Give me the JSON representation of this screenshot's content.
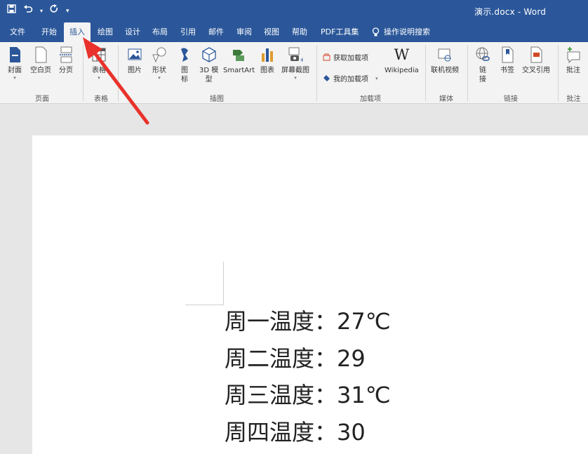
{
  "app": {
    "doc_title": "演示.docx  -  Word",
    "qat_caret": "▾"
  },
  "tabs": [
    {
      "label": "文件"
    },
    {
      "label": "开始"
    },
    {
      "label": "插入"
    },
    {
      "label": "绘图"
    },
    {
      "label": "设计"
    },
    {
      "label": "布局"
    },
    {
      "label": "引用"
    },
    {
      "label": "邮件"
    },
    {
      "label": "审阅"
    },
    {
      "label": "视图"
    },
    {
      "label": "帮助"
    },
    {
      "label": "PDF工具集"
    },
    {
      "label": "操作说明搜索"
    }
  ],
  "ribbon": {
    "pages": {
      "cover": "封面",
      "blank": "空白页",
      "break": "分页",
      "group": "页面"
    },
    "tables": {
      "table": "表格",
      "group": "表格"
    },
    "illus": {
      "picture": "图片",
      "shapes": "形状",
      "icons_1": "图",
      "icons_2": "标",
      "model_1": "3D 模",
      "model_2": "型",
      "smartart": "SmartArt",
      "chart": "图表",
      "screenshot": "屏幕截图",
      "group": "插图"
    },
    "addins": {
      "get": "获取加载项",
      "mine": "我的加载项",
      "wiki": "Wikipedia",
      "wiki_glyph": "W",
      "group": "加载项"
    },
    "media": {
      "video": "联机视频",
      "group": "媒体"
    },
    "links": {
      "link_1": "链",
      "link_2": "接",
      "bookmark": "书签",
      "xref": "交叉引用",
      "group": "链接"
    },
    "comments": {
      "comment": "批注",
      "group": "批注"
    }
  },
  "document": {
    "lines": [
      "周一温度：27℃",
      "周二温度：29",
      "周三温度：31℃",
      "周四温度：30"
    ]
  },
  "colors": {
    "word_blue": "#2b579a",
    "arrow_red": "#e8322b"
  }
}
